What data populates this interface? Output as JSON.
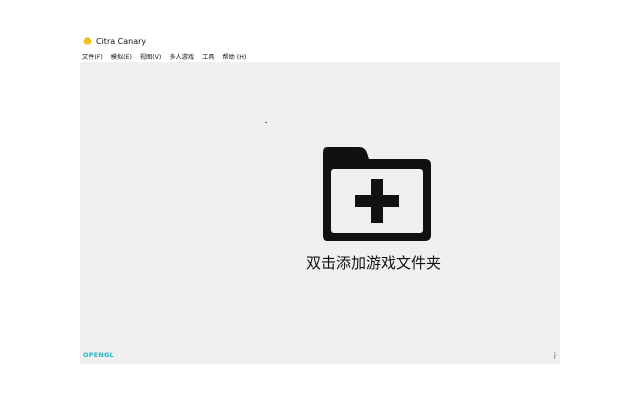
{
  "window": {
    "title": "Citra Canary"
  },
  "menubar": {
    "items": [
      {
        "label": "文件(F)"
      },
      {
        "label": "模拟(E)"
      },
      {
        "label": "视图(V)"
      },
      {
        "label": "多人游戏"
      },
      {
        "label": "工具"
      },
      {
        "label": "帮助 (H)"
      }
    ]
  },
  "main": {
    "add_folder_label": "双击添加游戏文件夹"
  },
  "statusbar": {
    "renderer": "OPENGL",
    "right_text": "j"
  },
  "colors": {
    "content_bg": "#f0f0f0",
    "renderer_text": "#22b8c0",
    "icon": "#111111"
  }
}
